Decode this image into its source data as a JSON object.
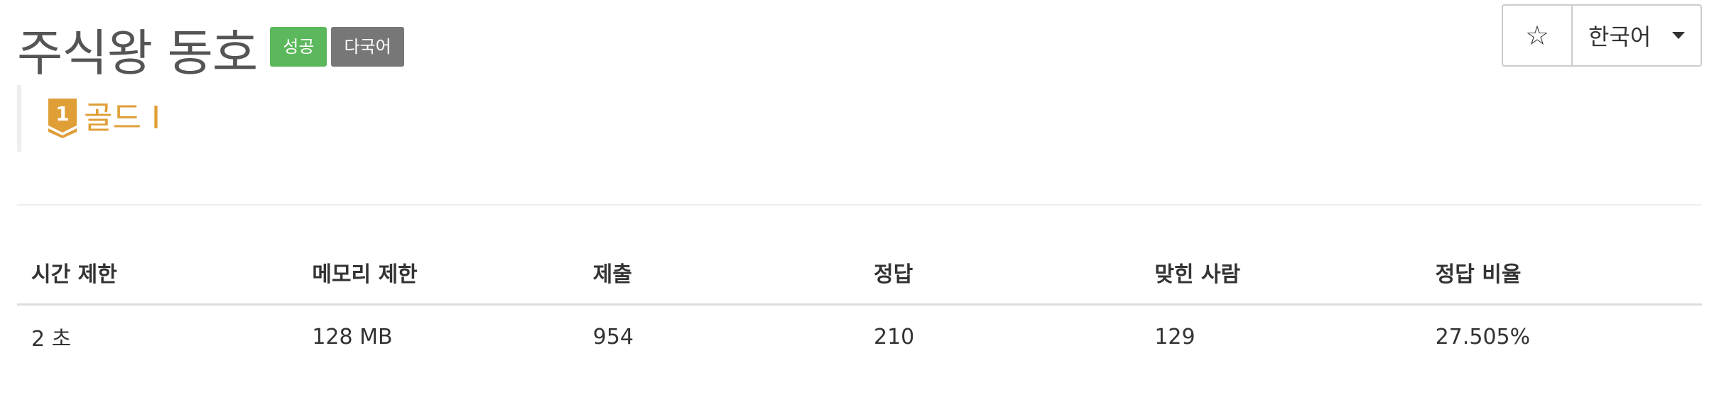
{
  "problem": {
    "title": "주식왕 동호",
    "labels": {
      "success": "성공",
      "multilang": "다국어"
    }
  },
  "actions": {
    "star_icon": "star-outline-icon",
    "star_glyph": "☆",
    "language": "한국어"
  },
  "tier": {
    "number": "1",
    "name": "골드 I",
    "color": "#e09e37"
  },
  "colors": {
    "success": "#5cb85c",
    "default": "#777777",
    "tier_gold": "#e09e37"
  },
  "info_table": {
    "headers": [
      "시간 제한",
      "메모리 제한",
      "제출",
      "정답",
      "맞힌 사람",
      "정답 비율"
    ],
    "rows": [
      [
        "2 초",
        "128 MB",
        "954",
        "210",
        "129",
        "27.505%"
      ]
    ]
  }
}
